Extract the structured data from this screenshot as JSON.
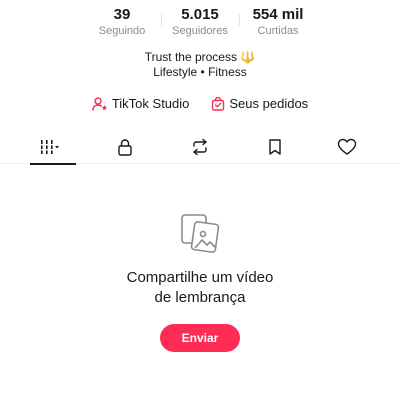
{
  "stats": [
    {
      "value": "39",
      "label": "Seguindo"
    },
    {
      "value": "5.015",
      "label": "Seguidores"
    },
    {
      "value": "554 mil",
      "label": "Curtidas"
    }
  ],
  "bio": {
    "line1": "Trust the process",
    "emoji": "🔱",
    "line2": "Lifestyle • Fitness"
  },
  "links": {
    "studio": "TikTok Studio",
    "orders": "Seus pedidos"
  },
  "tabs": [
    {
      "name": "videos",
      "icon": "grid-icon",
      "active": true
    },
    {
      "name": "private",
      "icon": "lock-icon",
      "active": false
    },
    {
      "name": "reposts",
      "icon": "repost-icon",
      "active": false
    },
    {
      "name": "saved",
      "icon": "bookmark-icon",
      "active": false
    },
    {
      "name": "liked",
      "icon": "heart-icon",
      "active": false
    }
  ],
  "empty_state": {
    "icon": "photos-icon",
    "title_line1": "Compartilhe um vídeo",
    "title_line2": "de lembrança",
    "button": "Enviar"
  },
  "colors": {
    "accent": "#fe2c55",
    "text": "#161823",
    "muted": "#8a8b91"
  }
}
